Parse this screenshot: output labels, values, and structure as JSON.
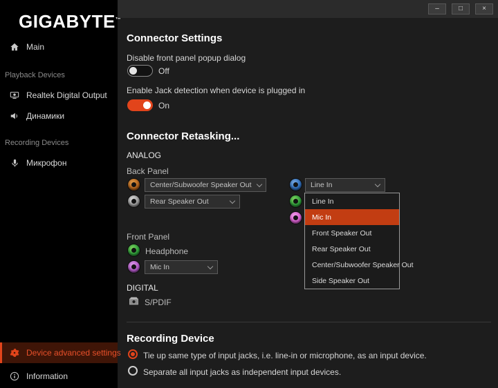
{
  "titlebar": {
    "minimize": "–",
    "maximize": "□",
    "close": "×"
  },
  "sidebar": {
    "logo": "GIGABYTE",
    "trademark": "™",
    "items": {
      "main": "Main",
      "playback_header": "Playback Devices",
      "realtek": "Realtek Digital Output",
      "speakers": "Динамики",
      "recording_header": "Recording Devices",
      "microphone": "Микрофон",
      "advanced": "Device advanced settings",
      "information": "Information"
    }
  },
  "connector_settings": {
    "title": "Connector Settings",
    "popup_label": "Disable front panel popup dialog",
    "popup_state": "Off",
    "jack_label": "Enable Jack detection when device is plugged in",
    "jack_state": "On"
  },
  "retasking": {
    "title": "Connector Retasking...",
    "analog_header": "ANALOG",
    "back_panel_label": "Back Panel",
    "back_jack1_value": "Center/Subwoofer Speaker Out",
    "back_jack2_value": "Rear Speaker Out",
    "back_jack3_value": "Line In",
    "front_panel_label": "Front Panel",
    "front_jack1_label": "Headphone",
    "front_jack2_value": "Mic In",
    "digital_header": "DIGITAL",
    "spdif_label": "S/PDIF"
  },
  "retask_menu": {
    "items": [
      "Line In",
      "Mic In",
      "Front Speaker Out",
      "Rear Speaker Out",
      "Center/Subwoofer Speaker Out",
      "Side Speaker Out"
    ],
    "selected": "Mic In"
  },
  "recording_device": {
    "title": "Recording Device",
    "tie_option": "Tie up same type of input jacks, i.e. line-in or microphone, as an input device.",
    "separate_option": "Separate all input jacks as independent input devices."
  },
  "colors": {
    "accent": "#e2441b",
    "selected_row_bg": "#3f1507",
    "jack_orange": "#b5651d",
    "jack_gray": "#9a9a9a",
    "jack_blue": "#2f6fbd",
    "jack_green": "#2e9e3a",
    "jack_pink": "#d95fd0",
    "jack_purple": "#b45bc9"
  }
}
